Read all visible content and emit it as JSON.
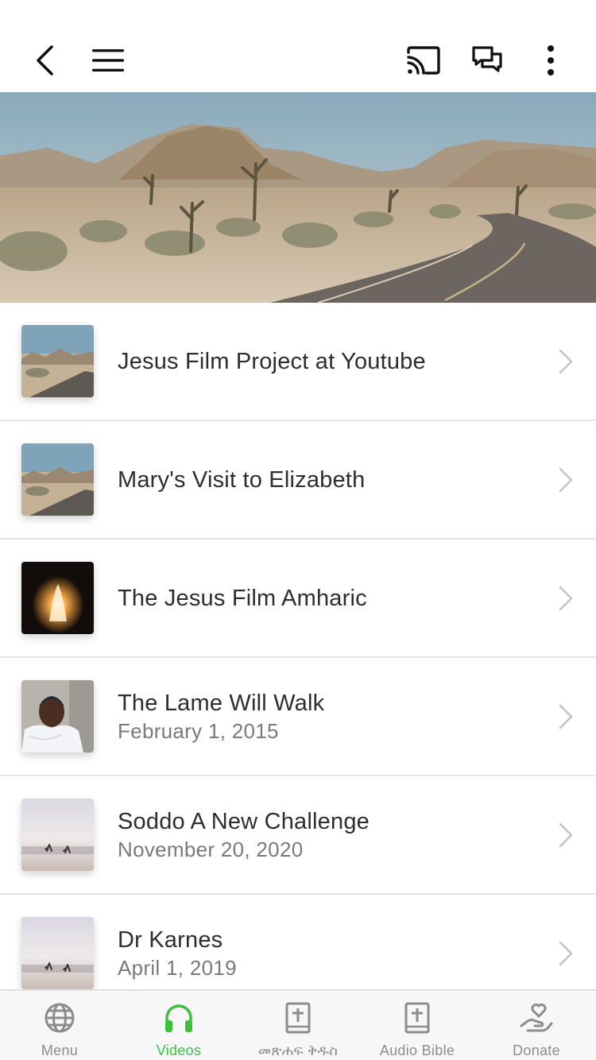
{
  "colors": {
    "accent": "#3cbf3a",
    "text_primary": "#2d2d2d",
    "text_secondary": "#7a7a7a",
    "icon_inactive": "#8c8c8c",
    "divider": "#e6e6e6"
  },
  "header": {
    "icons": [
      "back-icon",
      "hamburger-menu-icon",
      "cast-icon",
      "chat-icon",
      "more-vertical-icon"
    ]
  },
  "hero": {
    "image": "desert-road-landscape"
  },
  "items": [
    {
      "title": "Jesus Film Project at Youtube",
      "subtitle": "",
      "thumb": "desert-road"
    },
    {
      "title": "Mary's Visit to Elizabeth",
      "subtitle": "",
      "thumb": "desert-road"
    },
    {
      "title": "The Jesus Film Amharic",
      "subtitle": "",
      "thumb": "tomb-light"
    },
    {
      "title": "The Lame Will Walk",
      "subtitle": "February 1, 2015",
      "thumb": "portrait"
    },
    {
      "title": "Soddo A New Challenge",
      "subtitle": "November 20, 2020",
      "thumb": "beach-runners"
    },
    {
      "title": "Dr Karnes",
      "subtitle": "April 1, 2019",
      "thumb": "beach-runners"
    }
  ],
  "tabs": [
    {
      "label": "Menu",
      "icon": "globe-icon",
      "active": false
    },
    {
      "label": "Videos",
      "icon": "headphones-icon",
      "active": true
    },
    {
      "label": "መጽሐፍ ቅዱስ",
      "icon": "bible-icon",
      "active": false
    },
    {
      "label": "Audio Bible",
      "icon": "bible-icon",
      "active": false
    },
    {
      "label": "Donate",
      "icon": "donate-hand-heart-icon",
      "active": false
    }
  ]
}
